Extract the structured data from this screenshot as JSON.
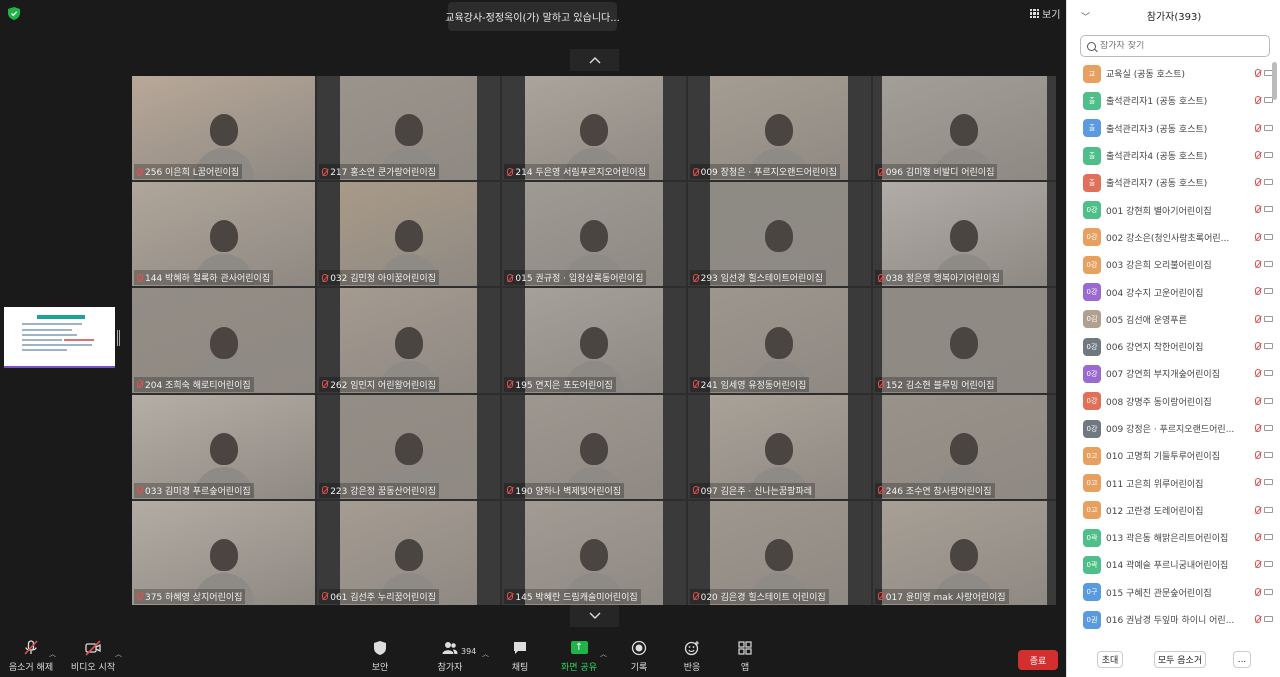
{
  "meeting": {
    "speaking_banner": "교육강사-정정옥이(가) 말하고 있습니다...",
    "view_label": "보기"
  },
  "gallery": [
    {
      "name": "256 이은희 L꿈어린이집",
      "tone": "#b8a898"
    },
    {
      "name": "217 홍소연 쿤가랑어린이집",
      "tone": "#9a948c"
    },
    {
      "name": "214 두은영 서림푸르지오어린이집",
      "tone": "#aaa49c"
    },
    {
      "name": "009 장청은 · 푸르지오랜드어린이집",
      "tone": "#a59d92"
    },
    {
      "name": "096 김미형 비발디 어린이집",
      "tone": "#a29e98"
    },
    {
      "name": "144 박혜하 철록하 관사어린이집",
      "tone": "#b0a69a"
    },
    {
      "name": "032 김민정 아이꿈어린이집",
      "tone": "#a89a88"
    },
    {
      "name": "015 권규정 · 입장상록동어린이집",
      "tone": "#9e9a94"
    },
    {
      "name": "293 임선경 힐스테이트어린이집",
      "tone": "#8e8a84"
    },
    {
      "name": "038 정은영 행복아기어린이집",
      "tone": "#b2aca8"
    },
    {
      "name": "204 조희숙 해로티어린이집",
      "tone": "#938d86"
    },
    {
      "name": "262 임민지 어린왕어린이집",
      "tone": "#a49a90"
    },
    {
      "name": "195 연지은 포도어린이집",
      "tone": "#a6a09a"
    },
    {
      "name": "241 임세영 유정동어린이집",
      "tone": "#9c968e"
    },
    {
      "name": "152 김소현 블루밍 어린이집",
      "tone": "#8f8a84"
    },
    {
      "name": "033 김미경 푸르숲어린이집",
      "tone": "#b4aea6"
    },
    {
      "name": "223 강은정 꿈동산어린이집",
      "tone": "#948d86"
    },
    {
      "name": "190 양하나 벽제빛어린이집",
      "tone": "#9d9790"
    },
    {
      "name": "097 김은주 · 신나는꿈팡파레",
      "tone": "#aaa298"
    },
    {
      "name": "246 조수연 참사랑어린이집",
      "tone": "#98928a"
    },
    {
      "name": "375 하혜영 상지어린이집",
      "tone": "#b2aca4"
    },
    {
      "name": "061 김선주 누리꿈어린이집",
      "tone": "#a59c92"
    },
    {
      "name": "145 박혜란 드림캐슬미어린이집",
      "tone": "#a19b94"
    },
    {
      "name": "020 김은경 힐스테이트 어린이집",
      "tone": "#9e978e"
    },
    {
      "name": "017 윤미영 mak 사랑어린이집",
      "tone": "#a8a096"
    }
  ],
  "toolbar": {
    "mute_label": "음소거 해제",
    "video_label": "비디오 시작",
    "security_label": "보안",
    "participants_label": "참가자",
    "participants_count": "394",
    "chat_label": "채팅",
    "share_label": "화면 공유",
    "record_label": "기록",
    "reactions_label": "반응",
    "apps_label": "앱",
    "end_label": "종료"
  },
  "panel": {
    "title": "참가자(393)",
    "search_placeholder": "참가자 찾기",
    "participants": [
      {
        "name": "교육실 (공동 호스트)",
        "avatar": "교",
        "color": "#e8a060"
      },
      {
        "name": "출석관리자1 (공동 호스트)",
        "avatar": "출",
        "color": "#4fbf8a"
      },
      {
        "name": "출석관리자3 (공동 호스트)",
        "avatar": "출",
        "color": "#5a9be0"
      },
      {
        "name": "출석관리자4 (공동 호스트)",
        "avatar": "출",
        "color": "#4fbf8a"
      },
      {
        "name": "출석관리자7 (공동 호스트)",
        "avatar": "출",
        "color": "#e0705a"
      },
      {
        "name": "001 강현희 별아기어린이집",
        "avatar": "0강",
        "color": "#4fbf8a"
      },
      {
        "name": "002 강소은(청인사랑초록어린...",
        "avatar": "0강",
        "color": "#e8a060"
      },
      {
        "name": "003 강은희 오리불어린이집",
        "avatar": "0강",
        "color": "#e8a060"
      },
      {
        "name": "004 강수지 고운어린이집",
        "avatar": "0강",
        "color": "#9a6ad0"
      },
      {
        "name": "005 김선애 운영푸른",
        "avatar": "0김",
        "color": "#b0a090"
      },
      {
        "name": "006 강연지 착한어린이집",
        "avatar": "0강",
        "color": "#707880"
      },
      {
        "name": "007 강연희 부지개숲어린이집",
        "avatar": "0강",
        "color": "#9a6ad0"
      },
      {
        "name": "008 강명주 동이랑어린이집",
        "avatar": "0강",
        "color": "#e0705a"
      },
      {
        "name": "009 강정은 · 푸르지오랜드어린...",
        "avatar": "0강",
        "color": "#707880"
      },
      {
        "name": "010 고명희 기들투루어린이집",
        "avatar": "0고",
        "color": "#e8a060"
      },
      {
        "name": "011 고은희 위루어린이집",
        "avatar": "0고",
        "color": "#e8a060"
      },
      {
        "name": "012 고란경 도레어린이집",
        "avatar": "0고",
        "color": "#e8a060"
      },
      {
        "name": "013 곽은동 해맑은리트어린이집",
        "avatar": "0곽",
        "color": "#4fbf8a"
      },
      {
        "name": "014 곽예슬 푸르니궁내어린이집",
        "avatar": "0곽",
        "color": "#4fbf8a"
      },
      {
        "name": "015 구혜진 관문숲어린이집",
        "avatar": "0구",
        "color": "#5a9be0"
      },
      {
        "name": "016 권남경 두잎마 하이니 어린...",
        "avatar": "0권",
        "color": "#5a9be0"
      }
    ],
    "invite_label": "초대",
    "mute_all_label": "모두 음소거",
    "more_label": "..."
  }
}
